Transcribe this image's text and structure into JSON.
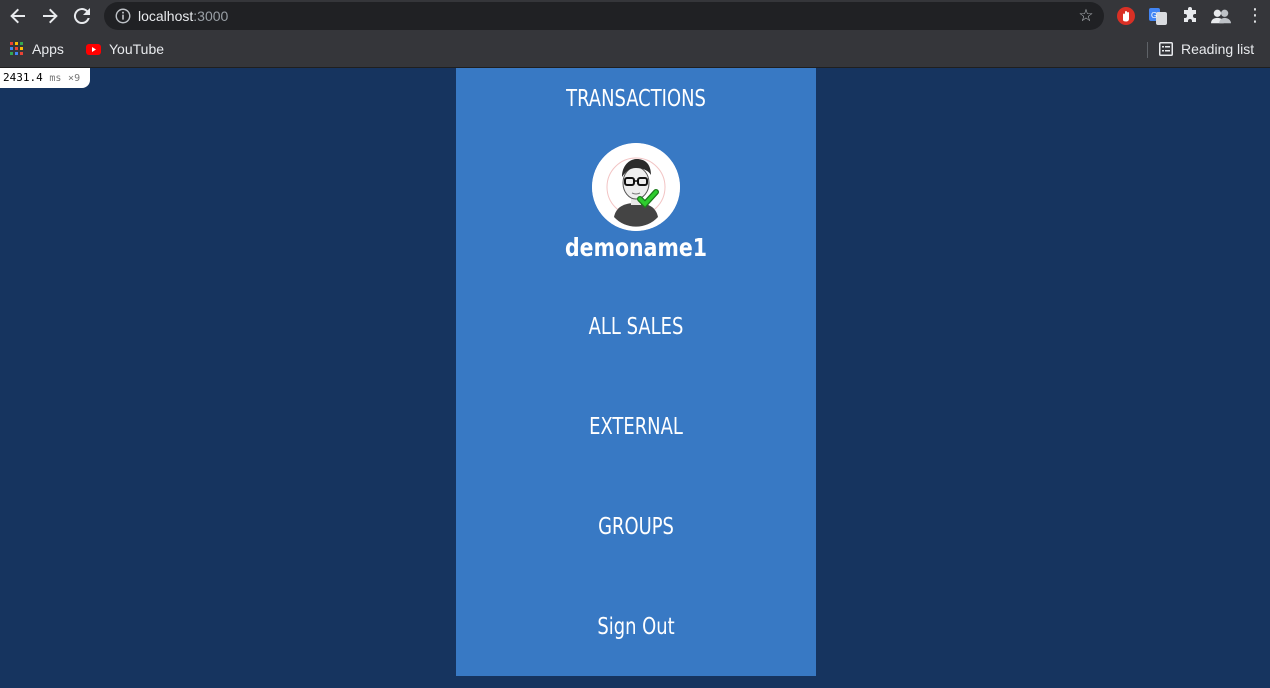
{
  "browser": {
    "url_host": "localhost",
    "url_port": ":3000",
    "bookmarks": [
      {
        "label": "Apps",
        "icon": "apps-grid-icon"
      },
      {
        "label": "YouTube",
        "icon": "youtube-icon"
      }
    ],
    "reading_list_label": "Reading list"
  },
  "perf_badge": {
    "value": "2431.4",
    "unit": "ms",
    "count": "×9"
  },
  "menu": {
    "title": "TRANSACTIONS",
    "username": "demoname1",
    "items": [
      "ALL SALES",
      "EXTERNAL",
      "GROUPS",
      "Sign Out"
    ],
    "background": "#3879c4"
  },
  "page_background": "#16345f"
}
